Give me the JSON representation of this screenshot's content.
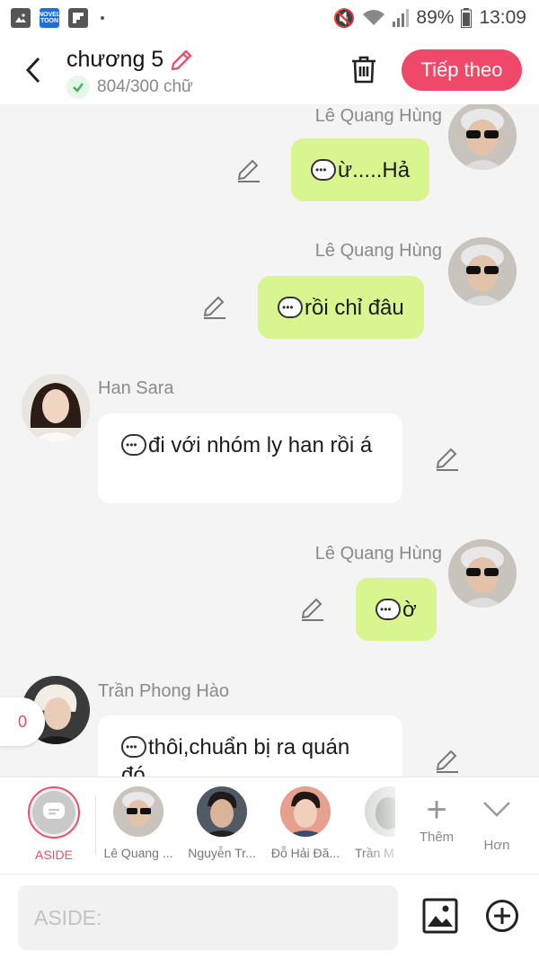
{
  "status_bar": {
    "battery": "89%",
    "time": "13:09",
    "app_badge": "NOVEL TOON"
  },
  "header": {
    "title": "chương 5",
    "word_count": "804/300 chữ",
    "next_label": "Tiếp theo"
  },
  "messages": [
    {
      "side": "right",
      "author": "Lê Quang Hùng",
      "text": "ừ.....Hả",
      "style": "green"
    },
    {
      "side": "right",
      "author": "Lê Quang Hùng",
      "text": "rồi chỉ đâu",
      "style": "green"
    },
    {
      "side": "left",
      "author": "Han Sara",
      "text": "đi với nhóm ly han rồi á",
      "style": "white"
    },
    {
      "side": "right",
      "author": "Lê Quang Hùng",
      "text": "ờ",
      "style": "green"
    },
    {
      "side": "left",
      "author": "Trần Phong Hào",
      "text": "thôi,chuẩn bị ra quán đó",
      "style": "white"
    }
  ],
  "unread_count": "0",
  "character_bar": {
    "aside_label": "ASIDE",
    "characters": [
      "Lê Quang ...",
      "Nguyễn Tr...",
      "Đỗ Hải Đă...",
      "Trần M"
    ],
    "more_label": "Thêm",
    "extra_label": "Hơn"
  },
  "composer": {
    "placeholder": "ASIDE:"
  },
  "colors": {
    "accent": "#f04868",
    "bubble_green": "#d9f590"
  }
}
